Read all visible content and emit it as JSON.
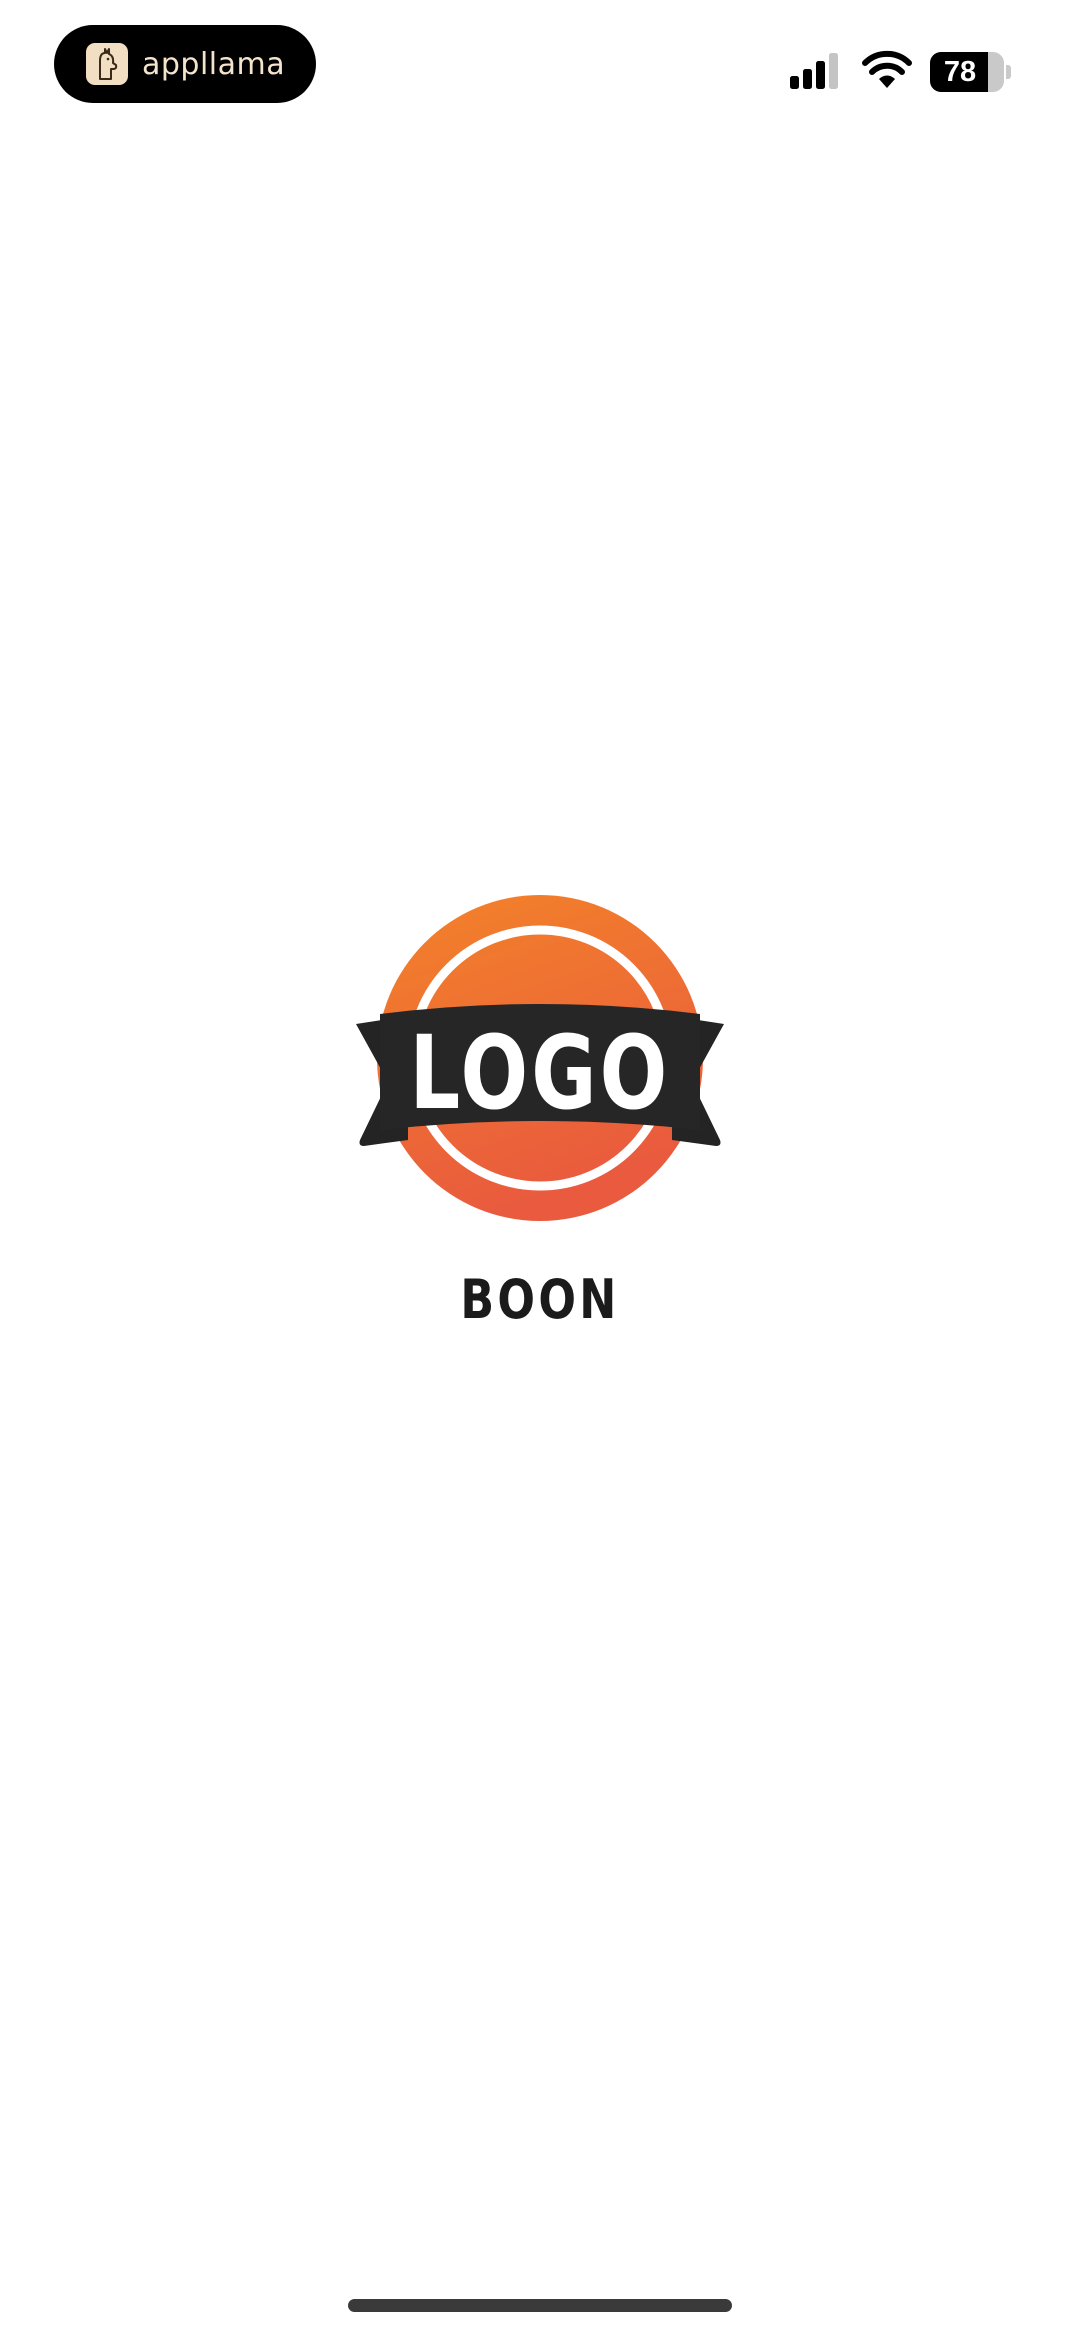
{
  "status_bar": {
    "app_pill_label": "appllama",
    "battery_level": "78",
    "battery_fraction": 0.78,
    "signal_bars_active": 3,
    "signal_bars_total": 4
  },
  "splash": {
    "logo_text": "LOGO",
    "brand_name": "BOON"
  },
  "colors": {
    "logo_orange_top": "#f07d2a",
    "logo_orange_bottom": "#ea5a3b",
    "ribbon": "#262626",
    "background": "#ffffff"
  },
  "icons": [
    "llama-icon",
    "cellular-signal-icon",
    "wifi-icon",
    "battery-icon"
  ]
}
